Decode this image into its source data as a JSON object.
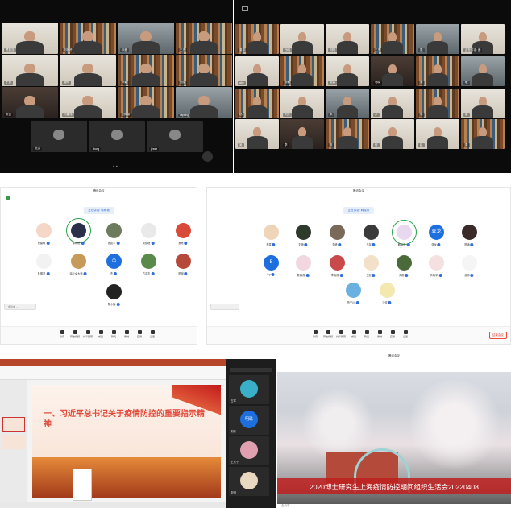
{
  "panel1": {
    "tiles": [
      {
        "name": "贾振亚"
      },
      {
        "name": "刘艳婷"
      },
      {
        "name": "朱雅"
      },
      {
        "name": "王杰"
      },
      {
        "name": "于勇"
      },
      {
        "name": "聂明"
      },
      {
        "name": "李颖"
      },
      {
        "name": "张晓"
      },
      {
        "name": "陈良"
      },
      {
        "name": "孙嘉伟"
      },
      {
        "name": "刘辉斯"
      },
      {
        "name": "cspring"
      },
      {
        "name": "范洪"
      },
      {
        "name": "rborg"
      },
      {
        "name": "jesse"
      }
    ]
  },
  "panel2": {
    "tiles": [
      {
        "name": "董平"
      },
      {
        "name": "孙晓"
      },
      {
        "name": "刘阳"
      },
      {
        "name": "王杰"
      },
      {
        "name": "张"
      },
      {
        "name": "正在讲话: 彭"
      },
      {
        "name": "aby"
      },
      {
        "name": "陈敏"
      },
      {
        "name": "张霖"
      },
      {
        "name": "马晓"
      },
      {
        "name": "宋"
      },
      {
        "name": "耿"
      },
      {
        "name": "杨"
      },
      {
        "name": "刘卉"
      },
      {
        "name": "朱"
      },
      {
        "name": "卢"
      },
      {
        "name": "华"
      },
      {
        "name": "崔"
      },
      {
        "name": "吴"
      },
      {
        "name": "李"
      },
      {
        "name": "陈"
      },
      {
        "name": "何"
      },
      {
        "name": "赵"
      },
      {
        "name": "周"
      },
      {
        "name": "徐晶"
      },
      {
        "name": "王"
      },
      {
        "name": "林"
      }
    ]
  },
  "panel3": {
    "title": "腾讯会议",
    "speaking": "正在讲话: 徐雨艳",
    "participants": [
      {
        "name": "曹婕敏"
      },
      {
        "name": "徐雨艳"
      },
      {
        "name": "张震宇"
      },
      {
        "name": "周佳峰"
      },
      {
        "name": "吴练"
      },
      {
        "name": "叶明凯"
      },
      {
        "name": "鸡少女大师"
      },
      {
        "name": "杰"
      },
      {
        "name": "方中志"
      },
      {
        "name": "陈婉"
      },
      {
        "name": "陈小梅"
      }
    ],
    "speaker_avatar_text": "杰",
    "share_bubble": "会议中 ...",
    "toolbar": [
      "静音",
      "开启视频",
      "共享屏幕",
      "成员",
      "聊天",
      "录制",
      "应用",
      "设置"
    ]
  },
  "panel4": {
    "title": "腾讯会议",
    "speaking": "正在讲话: 韩晓青",
    "participants": [
      {
        "name": "黄琴"
      },
      {
        "name": "刘静"
      },
      {
        "name": "李峰"
      },
      {
        "name": "王晨"
      },
      {
        "name": "韩晓青"
      },
      {
        "name": "张龙"
      },
      {
        "name": "陈涛"
      },
      {
        "name": "Ivy"
      },
      {
        "name": "陈春燕"
      },
      {
        "name": "李晓燕"
      },
      {
        "name": "王宏"
      },
      {
        "name": "周静"
      },
      {
        "name": "黄晓华"
      },
      {
        "name": "吴帅"
      },
      {
        "name": "鲁宁川"
      },
      {
        "name": "沈佳"
      }
    ],
    "badge_text": "亚龙",
    "ivy_letter": "B",
    "leave_button": "结束会议",
    "toolbar": [
      "静音",
      "开启视频",
      "共享屏幕",
      "成员",
      "聊天",
      "录制",
      "应用",
      "设置"
    ]
  },
  "panel5": {
    "slide_title": "一、习近平总书记关于疫情防控的重要指示精神",
    "side_names": [
      "石军",
      "明珠",
      "王东宁",
      "张明",
      "陈佳慧"
    ],
    "side_video_text": "明珠"
  },
  "panel6": {
    "title": "腾讯会议",
    "banner": "2020博士研究生上海疫情防控期间组织生活会20220408",
    "footer": "会议中 ..."
  }
}
